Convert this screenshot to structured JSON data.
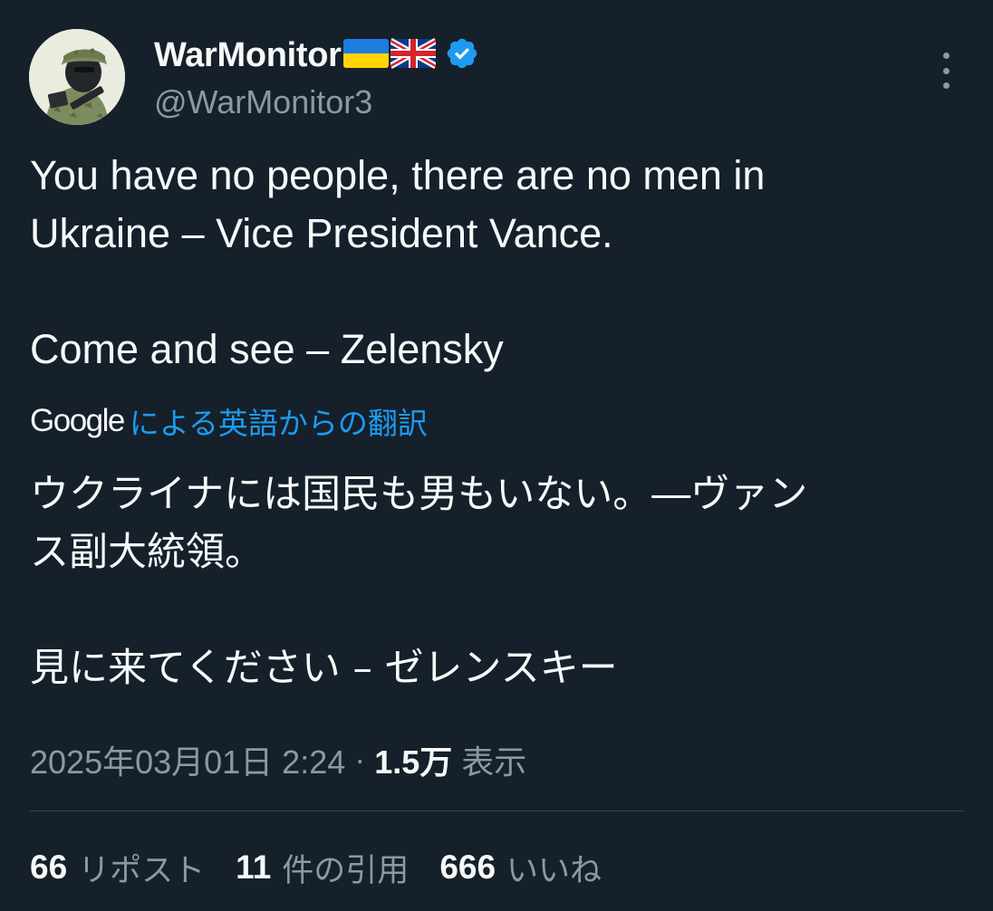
{
  "user": {
    "display_name": "WarMonitor",
    "handle": "@WarMonitor3",
    "flags": [
      "ukraine-flag",
      "uk-flag"
    ],
    "verified": true
  },
  "tweet": {
    "text": "You have no people, there are no men in\nUkraine – Vice President Vance.\n\nCome and see – Zelensky",
    "translation_provider": "Google",
    "translation_label": "による英語からの翻訳",
    "translated_text": "ウクライナには国民も男もいない。―ヴァン\nス副大統領。\n\n見に来てください – ゼレンスキー"
  },
  "meta": {
    "timestamp": "2025年03月01日 2:24",
    "separator": "·",
    "views_count": "1.5万",
    "views_label": "表示"
  },
  "stats": {
    "reposts_count": "66",
    "reposts_label": "リポスト",
    "quotes_count": "11",
    "quotes_label": "件の引用",
    "likes_count": "666",
    "likes_label": "いいね"
  },
  "colors": {
    "background": "#15202b",
    "text": "#f7f9f9",
    "secondary": "#8b98a5",
    "accent": "#1d9bf0"
  }
}
